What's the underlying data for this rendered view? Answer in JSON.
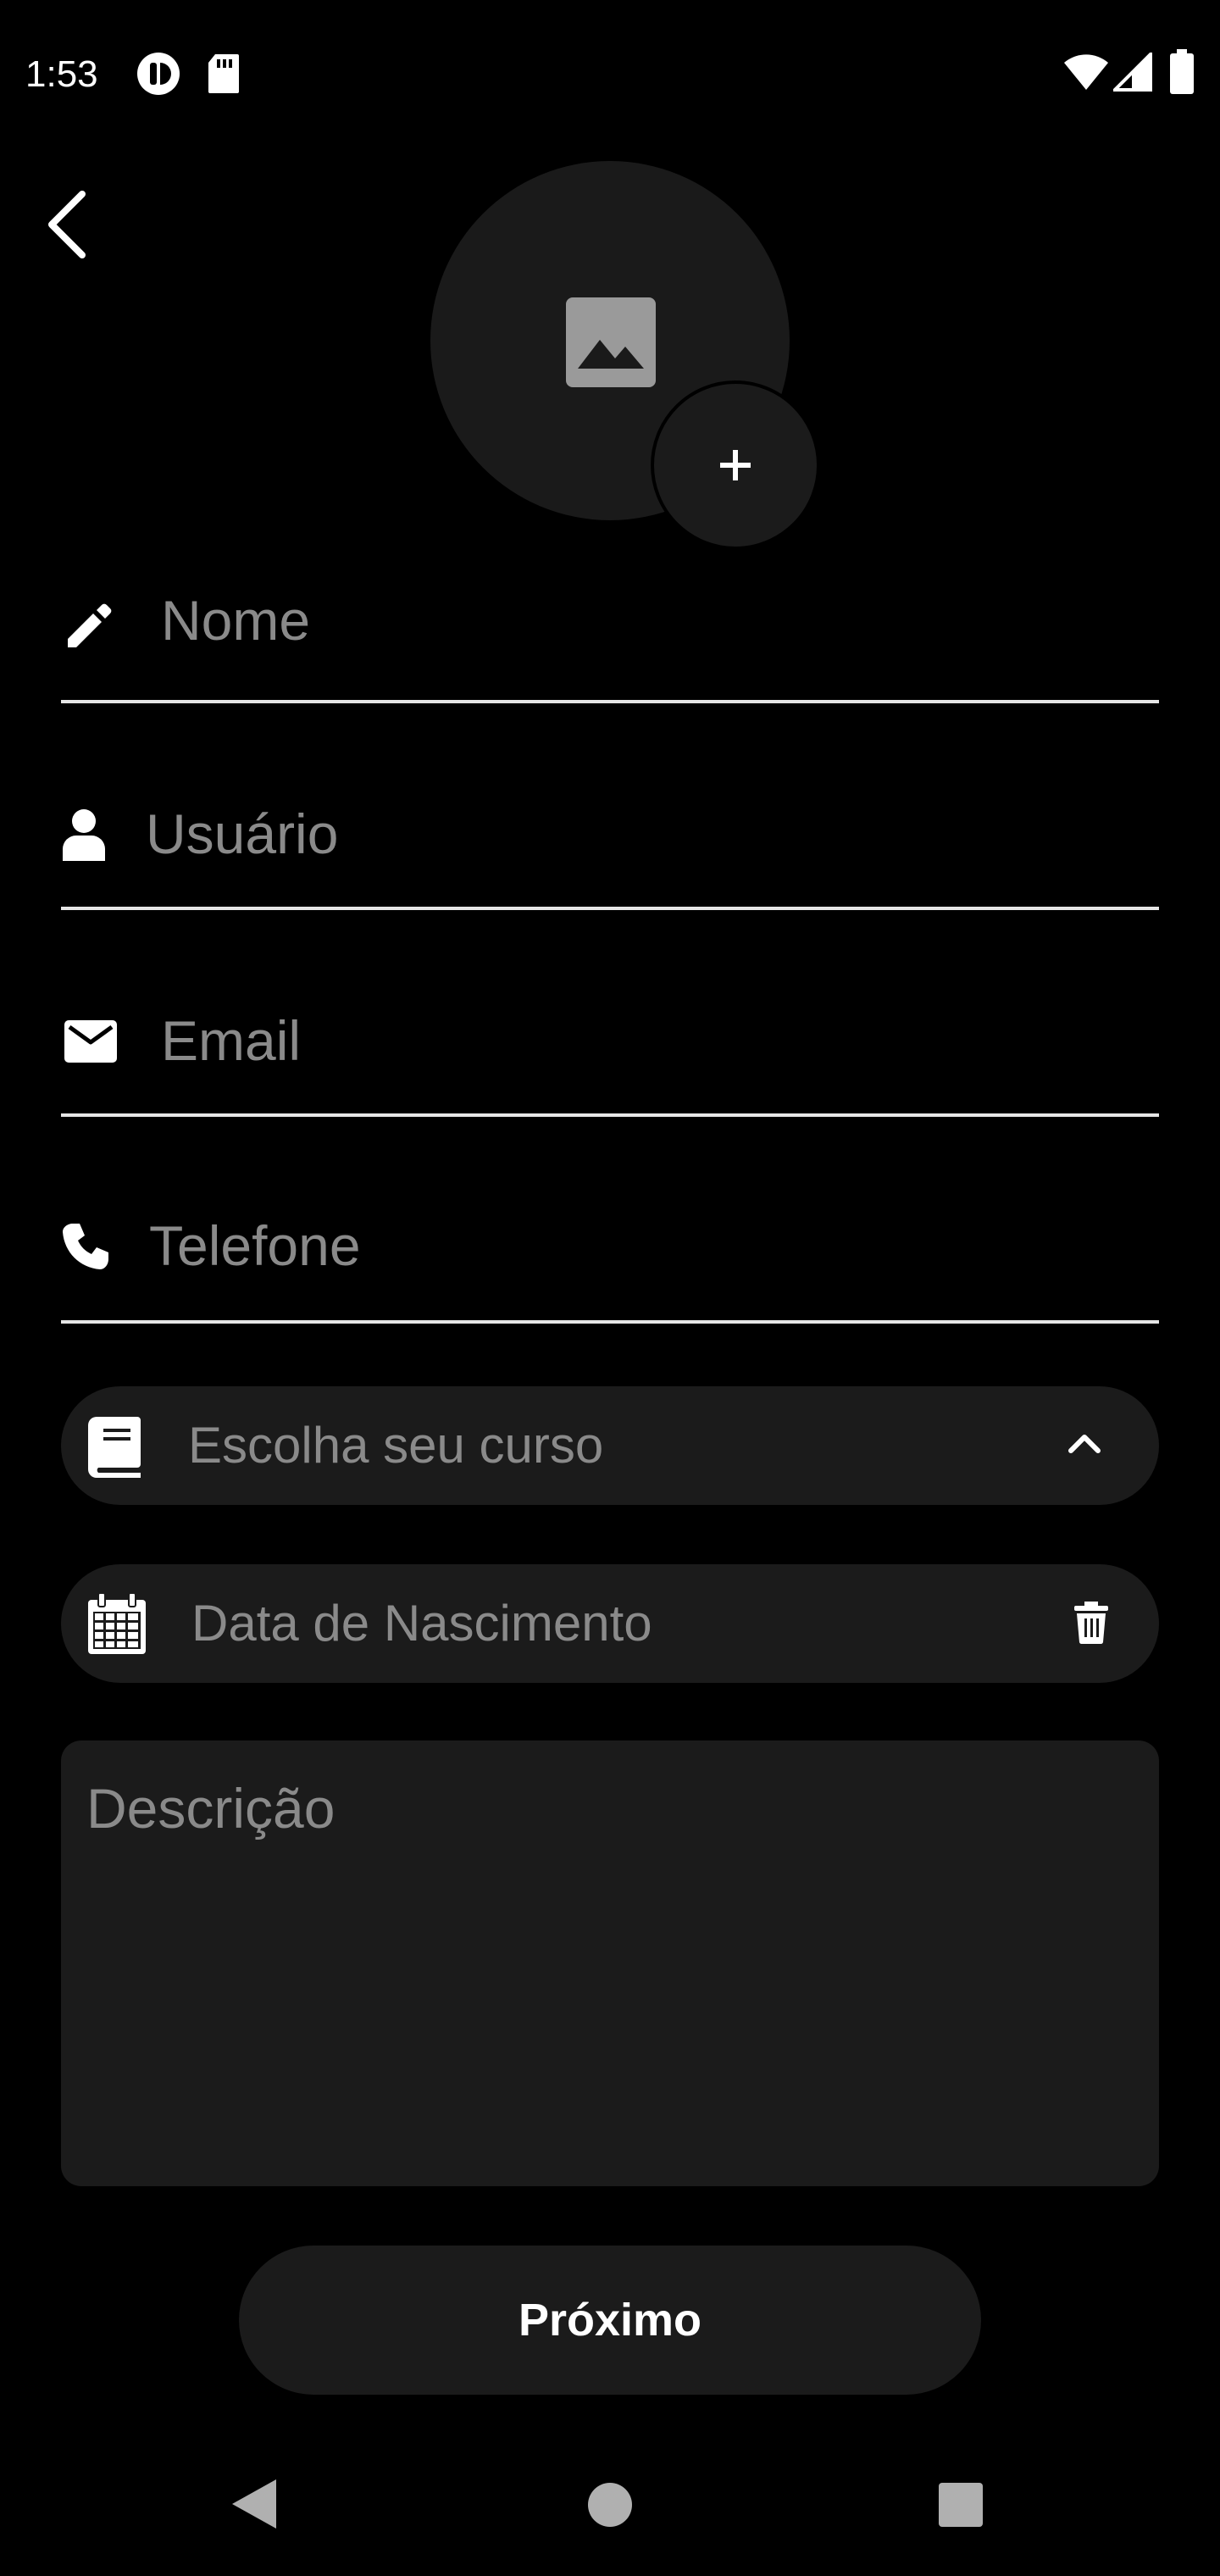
{
  "status_bar": {
    "time": "1:53",
    "left_icons": [
      "notification-app-icon",
      "sd-card-icon"
    ],
    "right_icons": [
      "wifi-icon",
      "cell-signal-icon",
      "battery-icon"
    ]
  },
  "header": {
    "back_icon": "chevron-left-icon"
  },
  "avatar": {
    "placeholder_icon": "image-icon",
    "add_label": "+"
  },
  "form": {
    "nome": {
      "placeholder": "Nome",
      "icon": "pencil-icon"
    },
    "usuario": {
      "placeholder": "Usuário",
      "icon": "person-icon"
    },
    "email": {
      "placeholder": "Email",
      "icon": "mail-icon"
    },
    "telefone": {
      "placeholder": "Telefone",
      "icon": "phone-icon"
    },
    "curso": {
      "placeholder": "Escolha seu curso",
      "icon": "book-icon",
      "trailing_icon": "chevron-up-icon"
    },
    "nascimento": {
      "placeholder": "Data de Nascimento",
      "icon": "calendar-icon",
      "trailing_icon": "trash-icon"
    },
    "descricao": {
      "placeholder": "Descrição"
    }
  },
  "actions": {
    "next_label": "Próximo"
  },
  "nav_bar": {
    "icons": [
      "nav-back-icon",
      "nav-home-icon",
      "nav-recents-icon"
    ]
  },
  "colors": {
    "background": "#000000",
    "surface": "#1b1b1b",
    "placeholder": "#8a8a8a",
    "text": "#ffffff"
  }
}
